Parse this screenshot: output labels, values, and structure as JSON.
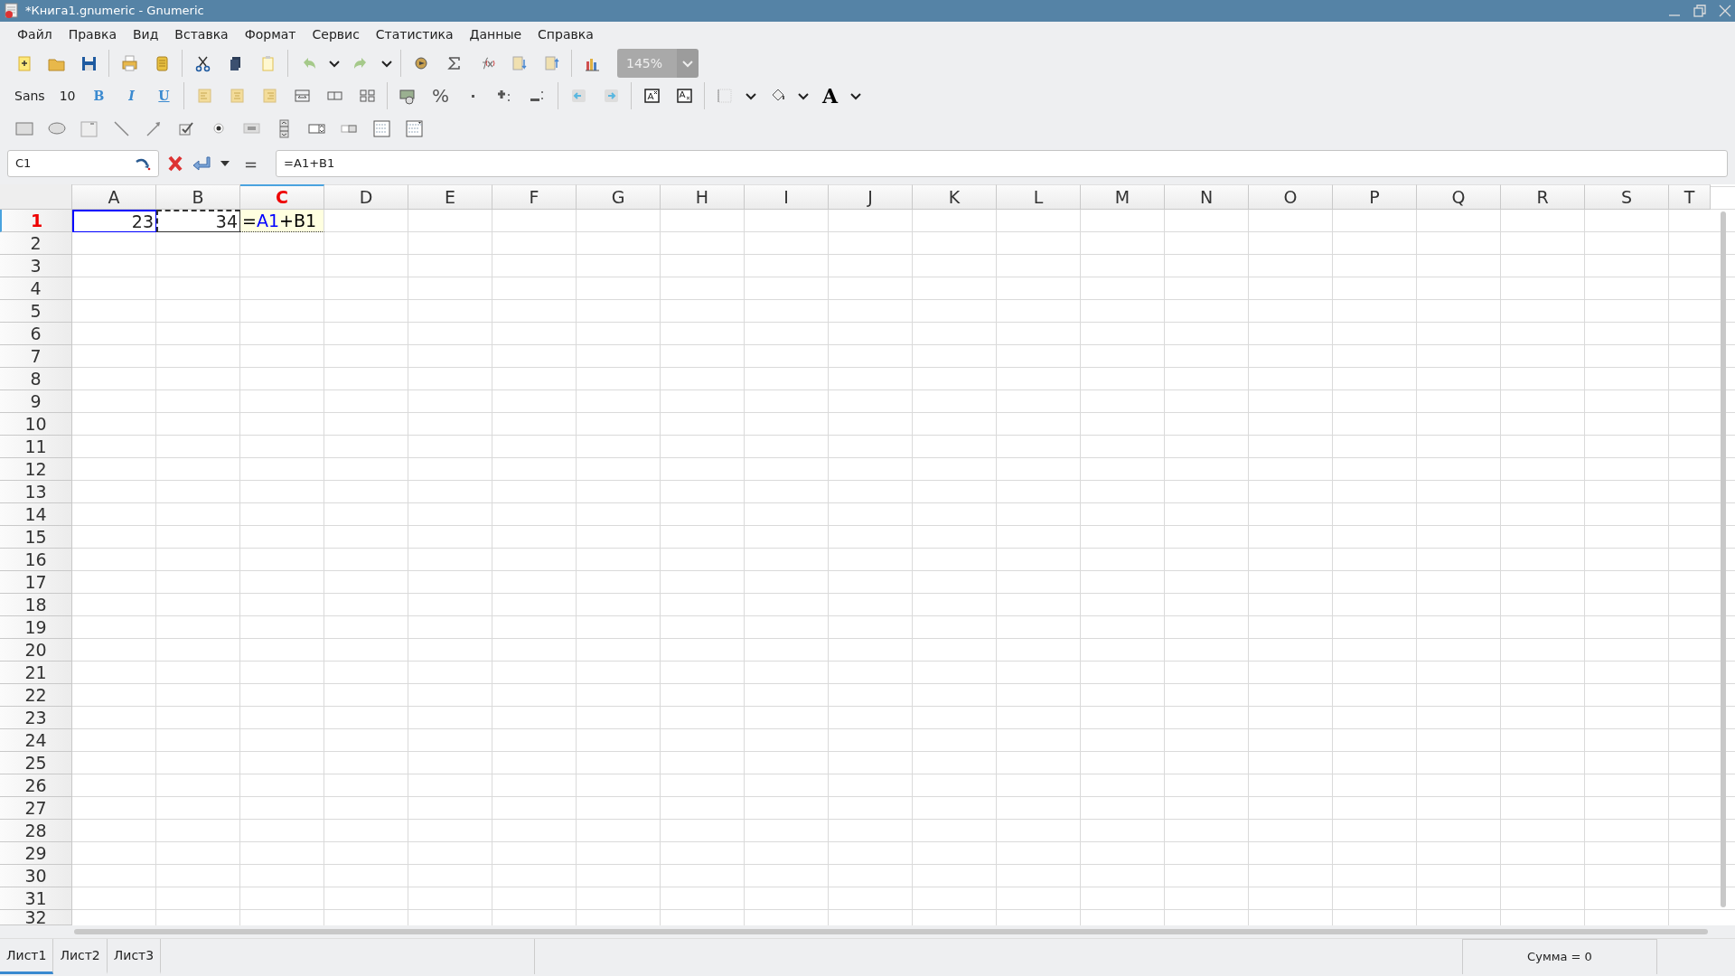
{
  "window": {
    "title": "*Книга1.gnumeric - Gnumeric"
  },
  "menu": [
    {
      "label": "Файл"
    },
    {
      "label": "Правка"
    },
    {
      "label": "Вид"
    },
    {
      "label": "Вставка"
    },
    {
      "label": "Формат"
    },
    {
      "label": "Сервис"
    },
    {
      "label": "Статистика"
    },
    {
      "label": "Данные"
    },
    {
      "label": "Справка"
    }
  ],
  "toolbar": {
    "zoom": {
      "value": "145%",
      "disabled": true
    },
    "font_name": "Sans",
    "font_size": "10",
    "bold": "B",
    "italic": "I",
    "underline": "U",
    "percent": "%",
    "font_color": "A"
  },
  "formula_bar": {
    "cell_name": "C1",
    "equals": "=",
    "value": "=A1+B1"
  },
  "sheet": {
    "columns": [
      {
        "label": "A",
        "selected": false
      },
      {
        "label": "B",
        "selected": false
      },
      {
        "label": "C",
        "selected": true
      },
      {
        "label": "D",
        "selected": false
      },
      {
        "label": "E",
        "selected": false
      },
      {
        "label": "F",
        "selected": false
      },
      {
        "label": "G",
        "selected": false
      },
      {
        "label": "H",
        "selected": false
      },
      {
        "label": "I",
        "selected": false
      },
      {
        "label": "J",
        "selected": false
      },
      {
        "label": "K",
        "selected": false
      },
      {
        "label": "L",
        "selected": false
      },
      {
        "label": "M",
        "selected": false
      },
      {
        "label": "N",
        "selected": false
      },
      {
        "label": "O",
        "selected": false
      },
      {
        "label": "P",
        "selected": false
      },
      {
        "label": "Q",
        "selected": false
      },
      {
        "label": "R",
        "selected": false
      },
      {
        "label": "S",
        "selected": false
      },
      {
        "label": "T",
        "selected": false
      }
    ],
    "rows": [
      {
        "label": "1",
        "selected": true,
        "cells": [
          {
            "kind": "value",
            "value": "23",
            "dashed": false,
            "color": "#0000ff"
          },
          {
            "kind": "value",
            "value": "34",
            "dashed": true,
            "color": "#333333"
          },
          {
            "kind": "editing",
            "parts": [
              {
                "text": "=",
                "color": "#000000"
              },
              {
                "text": "A1",
                "color": "#0000ff"
              },
              {
                "text": "+B1",
                "color": "#000000"
              }
            ]
          }
        ]
      },
      {
        "label": "2",
        "selected": false
      },
      {
        "label": "3",
        "selected": false
      },
      {
        "label": "4",
        "selected": false
      },
      {
        "label": "5",
        "selected": false
      },
      {
        "label": "6",
        "selected": false
      },
      {
        "label": "7",
        "selected": false
      },
      {
        "label": "8",
        "selected": false
      },
      {
        "label": "9",
        "selected": false
      },
      {
        "label": "10",
        "selected": false
      },
      {
        "label": "11",
        "selected": false
      },
      {
        "label": "12",
        "selected": false
      },
      {
        "label": "13",
        "selected": false
      },
      {
        "label": "14",
        "selected": false
      },
      {
        "label": "15",
        "selected": false
      },
      {
        "label": "16",
        "selected": false
      },
      {
        "label": "17",
        "selected": false
      },
      {
        "label": "18",
        "selected": false
      },
      {
        "label": "19",
        "selected": false
      },
      {
        "label": "20",
        "selected": false
      },
      {
        "label": "21",
        "selected": false
      },
      {
        "label": "22",
        "selected": false
      },
      {
        "label": "23",
        "selected": false
      },
      {
        "label": "24",
        "selected": false
      },
      {
        "label": "25",
        "selected": false
      },
      {
        "label": "26",
        "selected": false
      },
      {
        "label": "27",
        "selected": false
      },
      {
        "label": "28",
        "selected": false
      },
      {
        "label": "29",
        "selected": false
      },
      {
        "label": "30",
        "selected": false
      },
      {
        "label": "31",
        "selected": false
      },
      {
        "label": "32",
        "selected": false
      }
    ]
  },
  "sheet_tabs": [
    {
      "label": "Лист1",
      "selected": true
    },
    {
      "label": "Лист2",
      "selected": false
    },
    {
      "label": "Лист3",
      "selected": false
    }
  ],
  "status_bar": {
    "sum": "Сумма = 0"
  }
}
